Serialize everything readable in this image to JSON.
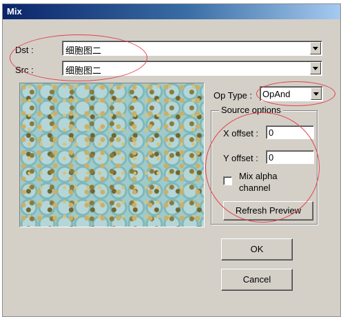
{
  "window": {
    "title": "Mix"
  },
  "dst": {
    "label": "Dst :",
    "value": "细胞图二"
  },
  "src": {
    "label": "Src :",
    "value": "细胞图二"
  },
  "op_type": {
    "label": "Op Type :",
    "value": "OpAnd"
  },
  "source_options": {
    "title": "Source options",
    "x_offset_label": "X offset :",
    "x_offset_value": "0",
    "y_offset_label": "Y offset :",
    "y_offset_value": "0",
    "mix_alpha_label_line1": "Mix alpha",
    "mix_alpha_label_line2": "channel",
    "mix_alpha_checked": false,
    "refresh_label": "Refresh Preview"
  },
  "buttons": {
    "ok": "OK",
    "cancel": "Cancel"
  },
  "colors": {
    "annotation": "#e0404a",
    "title_bar": "#0a246a"
  }
}
